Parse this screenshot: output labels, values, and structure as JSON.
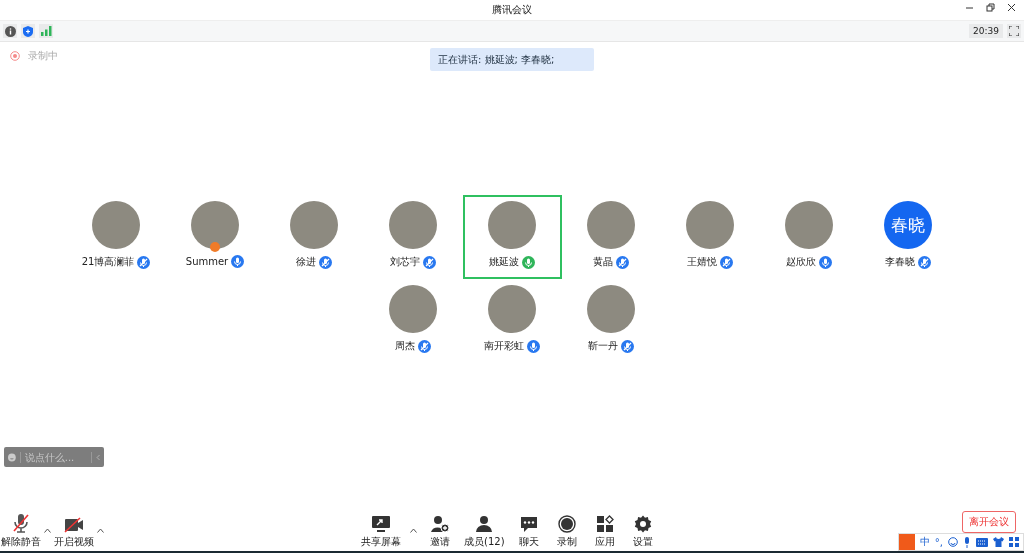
{
  "window": {
    "title": "腾讯会议"
  },
  "status": {
    "time": "20:39",
    "recording_label": "录制中"
  },
  "speaking_banner": "正在讲话: 姚延波; 李春晓;",
  "participants": [
    {
      "name": "21博高澜菲",
      "avatar": {
        "kind": "photo"
      },
      "muted": true,
      "speaking": false,
      "host": false
    },
    {
      "name": "Summer",
      "avatar": {
        "kind": "photo"
      },
      "muted": false,
      "speaking": false,
      "host": true
    },
    {
      "name": "徐进",
      "avatar": {
        "kind": "photo"
      },
      "muted": true,
      "speaking": false,
      "host": false
    },
    {
      "name": "刘芯宇",
      "avatar": {
        "kind": "photo"
      },
      "muted": true,
      "speaking": false,
      "host": false
    },
    {
      "name": "姚延波",
      "avatar": {
        "kind": "photo"
      },
      "muted": false,
      "speaking": true,
      "host": false
    },
    {
      "name": "黄晶",
      "avatar": {
        "kind": "photo"
      },
      "muted": true,
      "speaking": false,
      "host": false
    },
    {
      "name": "王婧悦",
      "avatar": {
        "kind": "photo"
      },
      "muted": true,
      "speaking": false,
      "host": false
    },
    {
      "name": "赵欣欣",
      "avatar": {
        "kind": "photo"
      },
      "muted": false,
      "speaking": false,
      "host": false
    },
    {
      "name": "李春晓",
      "avatar": {
        "kind": "text",
        "text": "春晓"
      },
      "muted": true,
      "speaking": false,
      "host": false
    },
    {
      "name": "周杰",
      "avatar": {
        "kind": "photo"
      },
      "muted": true,
      "speaking": false,
      "host": false
    },
    {
      "name": "南开彩虹",
      "avatar": {
        "kind": "photo"
      },
      "muted": false,
      "speaking": false,
      "host": false
    },
    {
      "name": "靳一丹",
      "avatar": {
        "kind": "photo"
      },
      "muted": true,
      "speaking": false,
      "host": false
    }
  ],
  "chat": {
    "placeholder": "说点什么..."
  },
  "toolbar_left": [
    {
      "kind": "mic",
      "label": "解除静音"
    },
    {
      "kind": "camera",
      "label": "开启视频"
    }
  ],
  "toolbar_center": [
    {
      "kind": "share",
      "label": "共享屏幕"
    },
    {
      "kind": "invite",
      "label": "邀请"
    },
    {
      "kind": "members",
      "label": "成员(12)"
    },
    {
      "kind": "chat",
      "label": "聊天"
    },
    {
      "kind": "record",
      "label": "录制"
    },
    {
      "kind": "apps",
      "label": "应用"
    },
    {
      "kind": "settings",
      "label": "设置"
    }
  ],
  "leave_button": "离开会议",
  "ime_bar": {
    "mode": "中",
    "punct": "°,"
  }
}
